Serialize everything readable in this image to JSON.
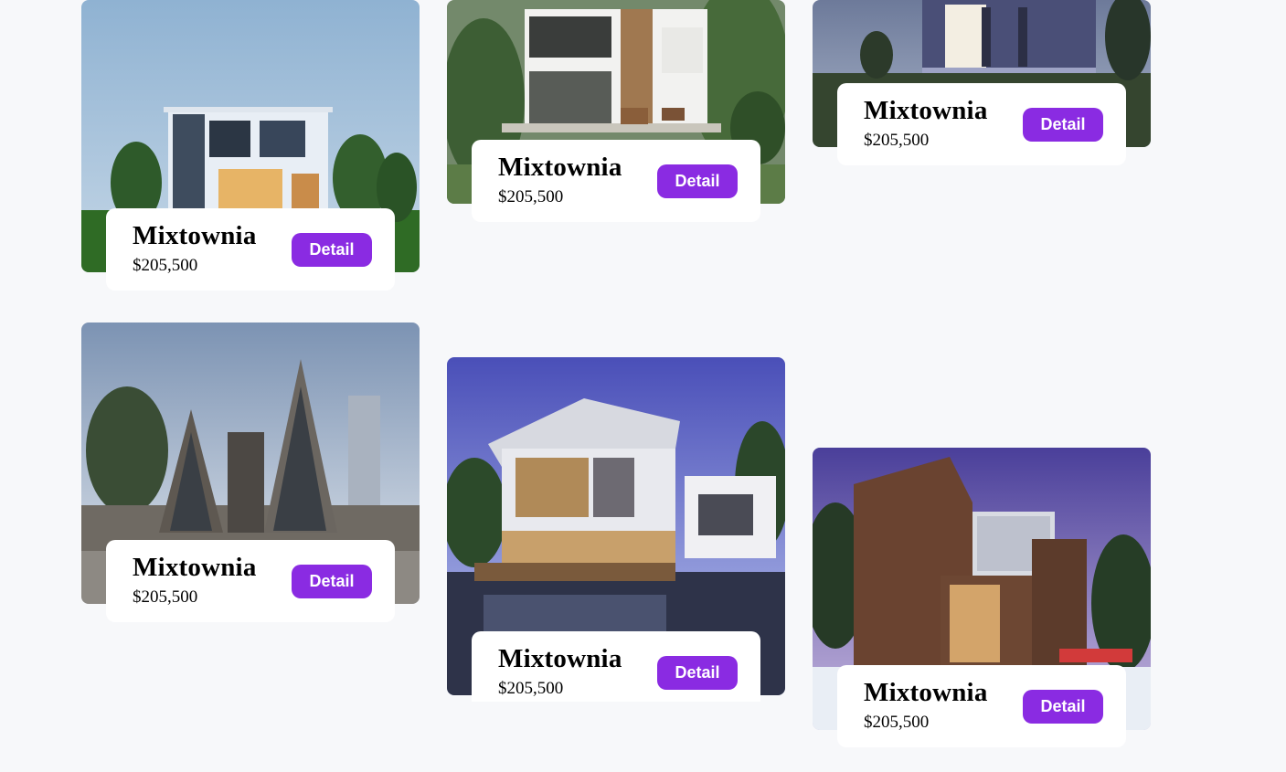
{
  "listings": [
    {
      "name": "Mixtownia",
      "price": "$205,500",
      "button_label": "Detail"
    },
    {
      "name": "Mixtownia",
      "price": "$205,500",
      "button_label": "Detail"
    },
    {
      "name": "Mixtownia",
      "price": "$205,500",
      "button_label": "Detail"
    },
    {
      "name": "Mixtownia",
      "price": "$205,500",
      "button_label": "Detail"
    },
    {
      "name": "Mixtownia",
      "price": "$205,500",
      "button_label": "Detail"
    },
    {
      "name": "Mixtownia",
      "price": "$205,500",
      "button_label": "Detail"
    }
  ],
  "colors": {
    "page_background": "#f7f8fa",
    "card_panel": "#ffffff",
    "button": "#8a2be2",
    "button_text": "#ffffff"
  }
}
